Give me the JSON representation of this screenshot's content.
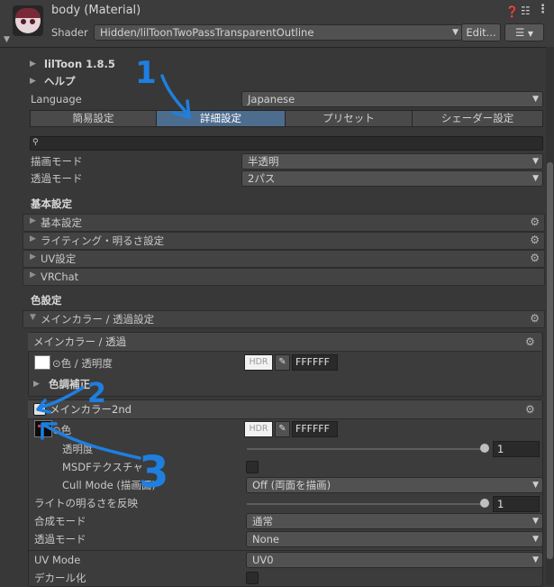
{
  "header": {
    "title": "body (Material)",
    "shader_label": "Shader",
    "shader_value": "Hidden/lilToonTwoPassTransparentOutline",
    "edit_button": "Edit...",
    "list_button": "☰"
  },
  "foldouts_top": {
    "liltoon": "lilToon 1.8.5",
    "help": "ヘルプ"
  },
  "language": {
    "label": "Language",
    "value": "Japanese"
  },
  "tabs": [
    {
      "label": "簡易設定",
      "selected": false
    },
    {
      "label": "詳細設定",
      "selected": true
    },
    {
      "label": "プリセット",
      "selected": false
    },
    {
      "label": "シェーダー設定",
      "selected": false
    }
  ],
  "search": {
    "placeholder": ""
  },
  "render_mode": {
    "label": "描画モード",
    "value": "半透明"
  },
  "transparency_mode": {
    "label": "透過モード",
    "value": "2パス"
  },
  "basic_settings": {
    "title": "基本設定",
    "items": [
      "基本設定",
      "ライティング・明るさ設定",
      "UV設定",
      "VRChat"
    ]
  },
  "color_settings": {
    "title": "色設定",
    "main_foldout": "メインカラー / 透過設定",
    "main_box": {
      "title": "メインカラー / 透過",
      "color_label": "色 / 透明度",
      "hdr": "HDR",
      "hex": "FFFFFF",
      "correction": "色調補正"
    },
    "second_box": {
      "title": "メインカラー2nd",
      "checked": true,
      "color_label": "色",
      "hdr": "HDR",
      "hex": "FFFFFF",
      "opacity_label": "透明度",
      "opacity_value": "1",
      "opacity_fraction": 1.0,
      "msdf_label": "MSDFテクスチャ",
      "msdf_checked": false,
      "cull_label": "Cull Mode (描画面)",
      "cull_value": "Off (両面を描画)",
      "light_label": "ライトの明るさを反映",
      "light_value": "1",
      "light_fraction": 1.0,
      "blend_label": "合成モード",
      "blend_value": "通常",
      "alpha_label": "透過モード",
      "alpha_value": "None",
      "uv_label": "UV Mode",
      "uv_value": "UV0",
      "decal_label": "デカール化",
      "decal_checked": false
    }
  },
  "annotations": {
    "n1": "1",
    "n2": "2",
    "n3": "3",
    "color": "#1e7fe0"
  }
}
